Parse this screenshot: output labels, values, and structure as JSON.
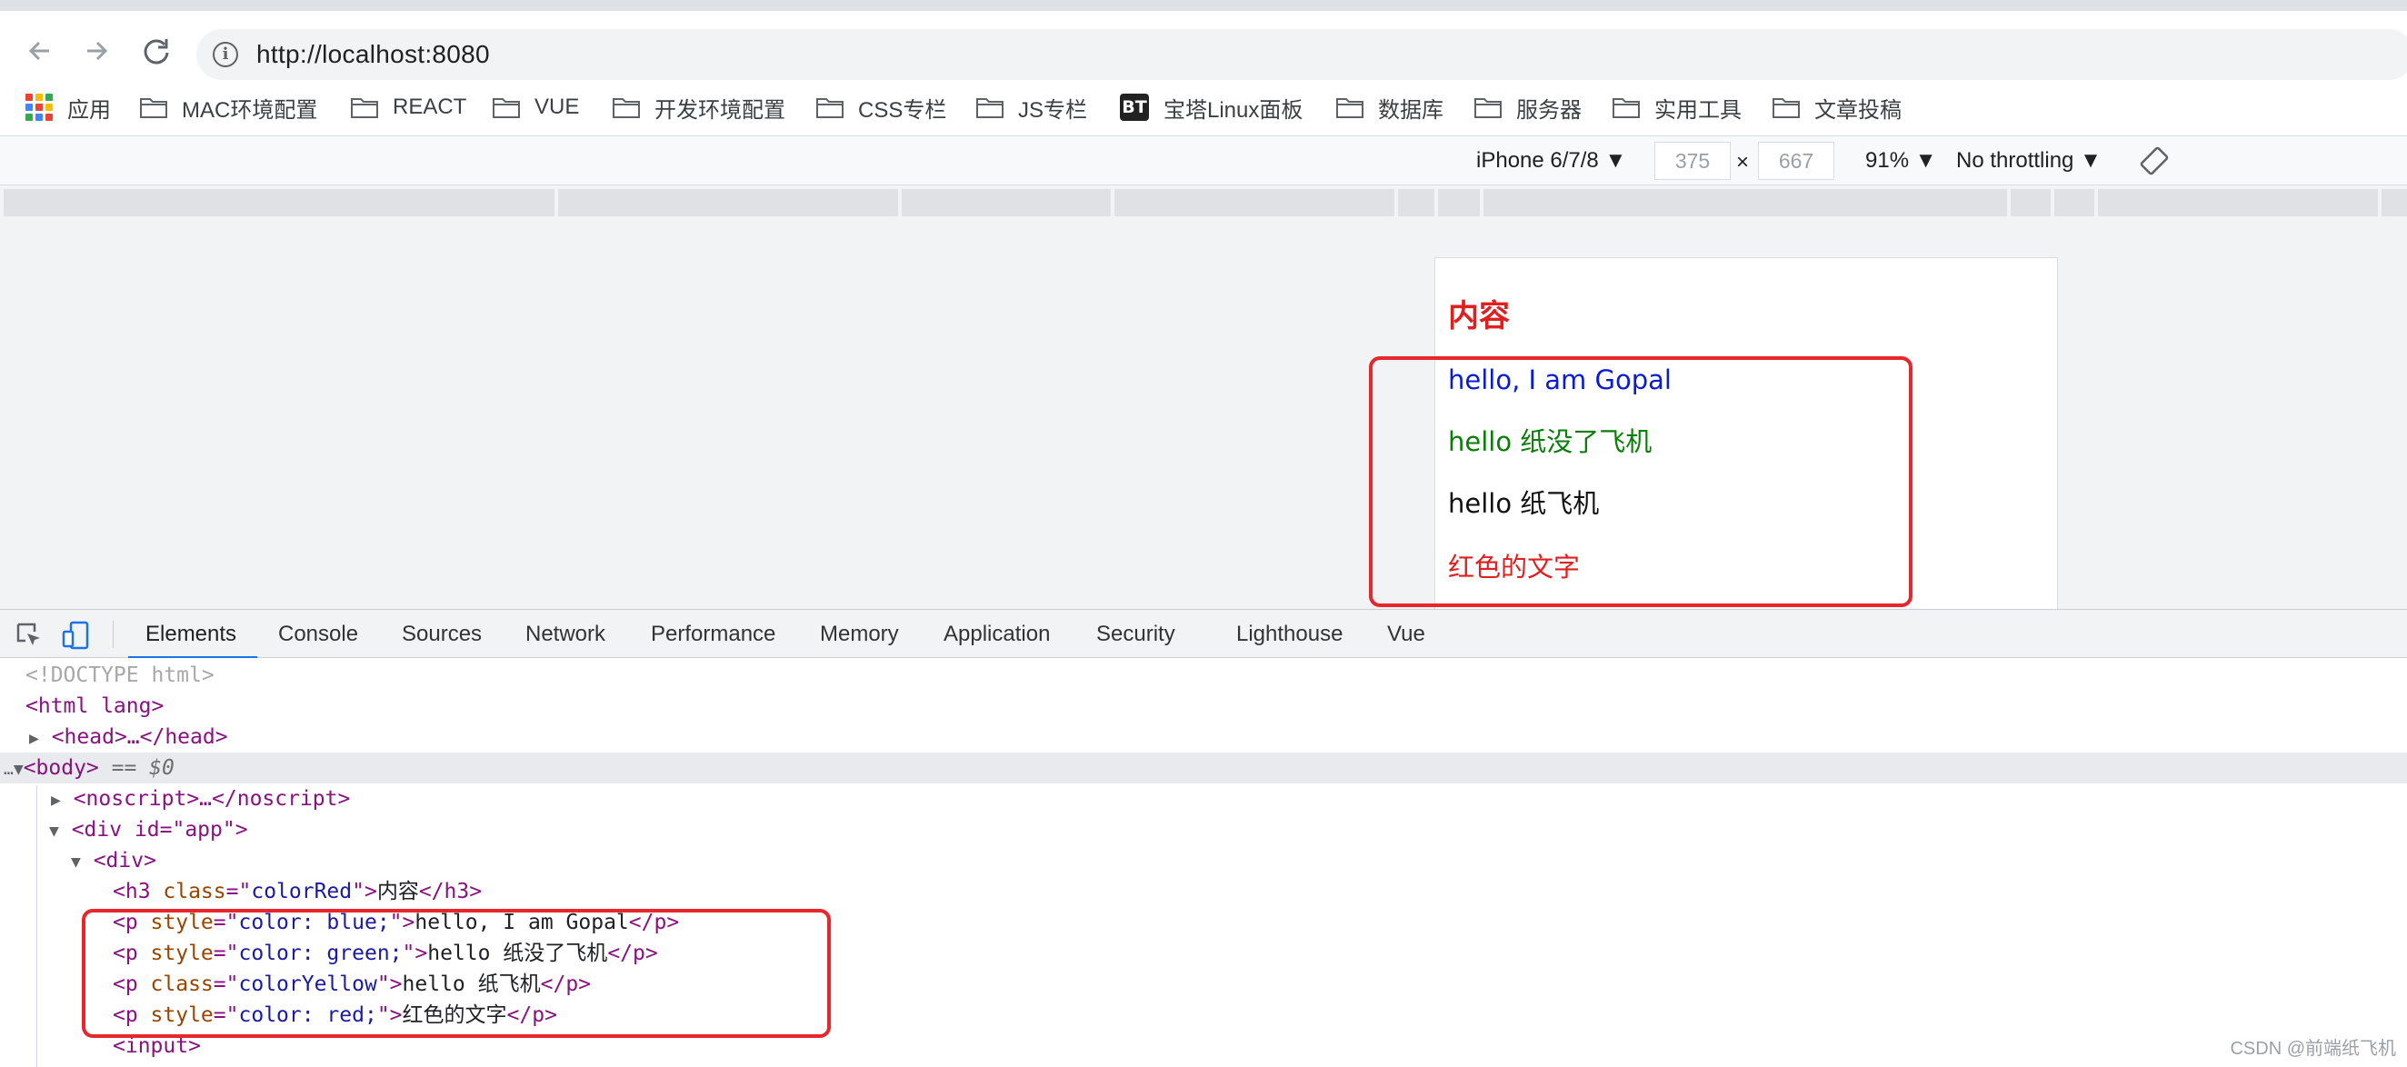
{
  "browser": {
    "url": "http://localhost:8080",
    "nav": {
      "back_icon": "arrow-left-icon",
      "forward_icon": "arrow-right-icon",
      "reload_icon": "reload-icon"
    }
  },
  "bookmarks": {
    "apps_label": "应用",
    "items": [
      "MAC环境配置",
      "REACT",
      "VUE",
      "开发环境配置",
      "CSS专栏",
      "JS专栏",
      "宝塔Linux面板",
      "数据库",
      "服务器",
      "实用工具",
      "文章投稿"
    ],
    "bt_badge": "BT"
  },
  "device_toolbar": {
    "device": "iPhone 6/7/8 ▼",
    "width": "375",
    "times": "×",
    "height": "667",
    "zoom": "91% ▼",
    "throttling": "No throttling ▼"
  },
  "page": {
    "heading": "内容",
    "lines": [
      {
        "text": "hello, I am Gopal",
        "color": "#0a1bd6"
      },
      {
        "text": "hello 纸没了飞机",
        "color": "#0a7d0a"
      },
      {
        "text": "hello 纸飞机",
        "color": "#111111"
      },
      {
        "text": "红色的文字",
        "color": "#e02020"
      }
    ]
  },
  "devtools": {
    "tabs": [
      "Elements",
      "Console",
      "Sources",
      "Network",
      "Performance",
      "Memory",
      "Application",
      "Security",
      "Lighthouse",
      "Vue"
    ],
    "active_tab": "Elements",
    "dom": {
      "doctype": "<!DOCTYPE html>",
      "html_open": "<html lang>",
      "head": "<head>…</head>",
      "body_tag": "<body>",
      "body_eq": " == $0",
      "noscript": "<noscript>…</noscript>",
      "div_app": "<div id=\"app\">",
      "div": "<div>",
      "h3_class_val": "colorRed",
      "h3_text": "内容",
      "p1_style": "color: blue;",
      "p1_text": "hello, I am Gopal",
      "p2_style": "color: green;",
      "p2_text": "hello 纸没了飞机",
      "p3_class": "colorYellow",
      "p3_text": "hello 纸飞机",
      "p4_style": "color: red;",
      "p4_text": "红色的文字",
      "input": "<input>"
    }
  },
  "watermark": "CSDN @前端纸飞机"
}
